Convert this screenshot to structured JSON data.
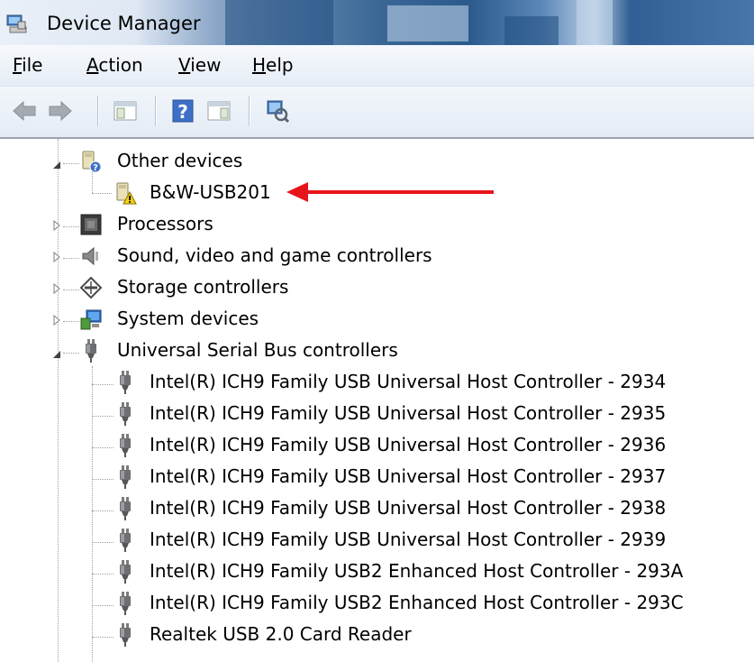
{
  "window": {
    "title": "Device Manager"
  },
  "menu": [
    {
      "accel": "F",
      "rest": "ile"
    },
    {
      "accel": "A",
      "rest": "ction"
    },
    {
      "accel": "V",
      "rest": "iew"
    },
    {
      "accel": "H",
      "rest": "elp"
    }
  ],
  "toolbar": {
    "buttons": [
      "back-arrow-icon",
      "forward-arrow-icon",
      "show-hide-console-tree-icon",
      "help-icon",
      "show-action-pane-icon",
      "scan-hardware-icon"
    ]
  },
  "tree": {
    "other_devices": {
      "label": "Other devices",
      "expanded": true,
      "icon": "unknown-device-icon"
    },
    "bw_usb201": {
      "label": "B&W-USB201",
      "icon": "warning-device-icon"
    },
    "processors": {
      "label": "Processors",
      "expanded": false,
      "icon": "processor-icon"
    },
    "sound": {
      "label": "Sound, video and game controllers",
      "expanded": false,
      "icon": "speaker-icon"
    },
    "storage": {
      "label": "Storage controllers",
      "expanded": false,
      "icon": "storage-icon"
    },
    "system": {
      "label": "System devices",
      "expanded": false,
      "icon": "system-icon"
    },
    "usb": {
      "label": "Universal Serial Bus controllers",
      "expanded": true,
      "icon": "usb-plug-icon",
      "children": [
        "Intel(R) ICH9 Family USB Universal Host Controller - 2934",
        "Intel(R) ICH9 Family USB Universal Host Controller - 2935",
        "Intel(R) ICH9 Family USB Universal Host Controller - 2936",
        "Intel(R) ICH9 Family USB Universal Host Controller - 2937",
        "Intel(R) ICH9 Family USB Universal Host Controller - 2938",
        "Intel(R) ICH9 Family USB Universal Host Controller - 2939",
        "Intel(R) ICH9 Family USB2 Enhanced Host Controller - 293A",
        "Intel(R) ICH9 Family USB2 Enhanced Host Controller - 293C",
        "Realtek USB 2.0 Card Reader"
      ]
    }
  },
  "colors": {
    "annotation_arrow": "#e8141b",
    "title_gradient_dark": "#2b5a8c"
  }
}
